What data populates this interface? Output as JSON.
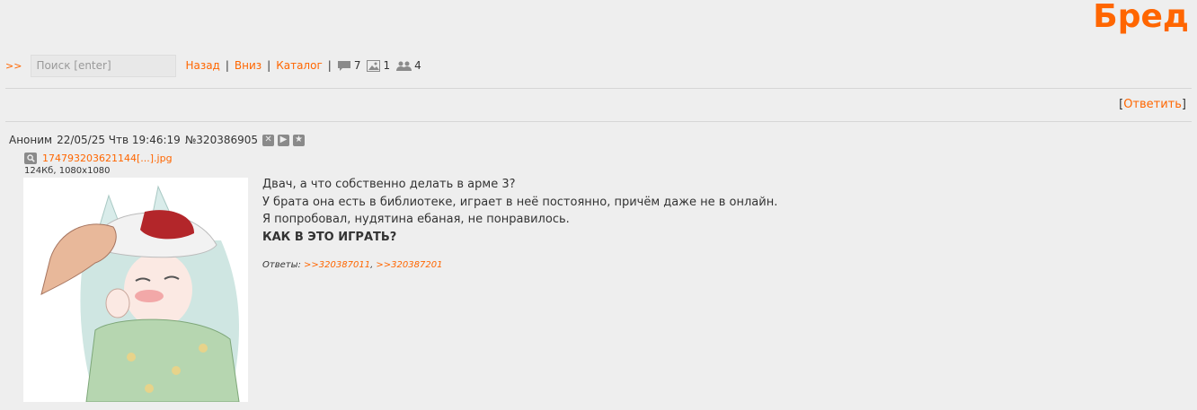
{
  "board": {
    "title": "Бред"
  },
  "topbar": {
    "arrows": ">>",
    "search_placeholder": "Поиск [enter]",
    "links": [
      "Назад",
      "Вниз",
      "Каталог"
    ],
    "stats": {
      "posts": "7",
      "images": "1",
      "users": "4"
    }
  },
  "reply": {
    "open": "[",
    "label": "Ответить",
    "close": "]"
  },
  "post": {
    "author": "Аноним",
    "date": "22/05/25 Чтв 19:46:19",
    "number": "№320386905",
    "file": {
      "name": "17479320362114­4[...].jpg",
      "meta": "124Кб, 1080x1080"
    },
    "body": [
      "Двач, а что собственно делать в арме 3?",
      "У брата она есть в библиотеке, играет в неё постоянно, причём даже не в онлайн.",
      "Я попробовал, нудятина ебаная, не понравилось."
    ],
    "body_bold": "КАК В ЭТО ИГРАТЬ?",
    "replies_label": "Ответы:",
    "replies": [
      ">>320387011",
      ">>320387201"
    ]
  }
}
